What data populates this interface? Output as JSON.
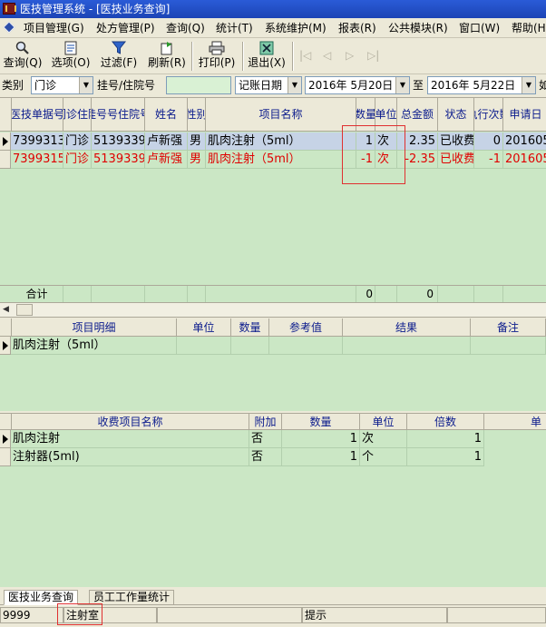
{
  "window": {
    "title": "医技管理系统 - [医技业务查询]"
  },
  "menu": [
    "项目管理(G)",
    "处方管理(P)",
    "查询(Q)",
    "统计(T)",
    "系统维护(M)",
    "报表(R)",
    "公共模块(R)",
    "窗口(W)",
    "帮助(H)"
  ],
  "toolbar": {
    "query": "查询(Q)",
    "options": "选项(O)",
    "filter": "过滤(F)",
    "refresh": "刷新(R)",
    "print": "打印(P)",
    "exit": "退出(X)"
  },
  "filters": {
    "category_label": "类别",
    "category_value": "门诊",
    "reg_label": "挂号/住院号",
    "date_type": "记账日期",
    "date_from": "2016年 5月20日",
    "to_label": "至",
    "date_to": "2016年 5月22日",
    "trailing": "如"
  },
  "main_grid": {
    "headers": [
      "医技单据号",
      "门诊住院",
      "挂号号住院号",
      "姓名",
      "性别",
      "项目名称",
      "数量",
      "单位",
      "总金额",
      "状态",
      "执行次数",
      "申请日"
    ],
    "rows": [
      [
        "7399313",
        "门诊",
        "5139339",
        "卢新强",
        "男",
        "肌肉注射（5ml）",
        "1",
        "次",
        "2.35",
        "已收费",
        "0",
        "201605"
      ],
      [
        "7399315",
        "门诊",
        "5139339",
        "卢新强",
        "男",
        "肌肉注射（5ml）",
        "-1",
        "次",
        "-2.35",
        "已收费",
        "-1",
        "201605"
      ]
    ],
    "total_label": "合计",
    "total_qty": "0",
    "total_amount": "0"
  },
  "detail_grid": {
    "headers": [
      "项目明细",
      "单位",
      "数量",
      "参考值",
      "结果",
      "备注"
    ],
    "rows": [
      [
        "肌肉注射（5ml）"
      ]
    ]
  },
  "fee_grid": {
    "headers": [
      "收费项目名称",
      "附加",
      "数量",
      "单位",
      "倍数",
      "单"
    ],
    "rows": [
      [
        "肌肉注射",
        "否",
        "1",
        "次",
        "1"
      ],
      [
        "注射器(5ml)",
        "否",
        "1",
        "个",
        "1"
      ]
    ]
  },
  "tabs": [
    "医技业务查询",
    "员工工作量统计"
  ],
  "statusbar": {
    "user": "9999",
    "dept": "注射室",
    "hint": "提示"
  },
  "colors": {
    "grid_bg": "#cbe7c5",
    "highlight_red": "#e00000",
    "selection": "#c6d3e6"
  }
}
